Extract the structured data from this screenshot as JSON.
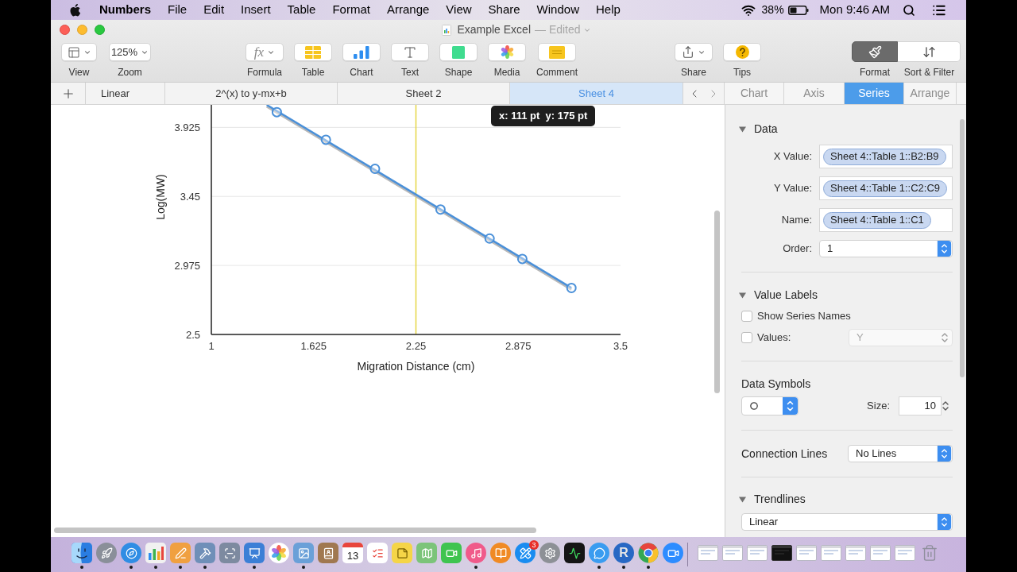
{
  "menu_bar": {
    "app_name": "Numbers",
    "menus": [
      "File",
      "Edit",
      "Insert",
      "Table",
      "Format",
      "Arrange",
      "View",
      "Share",
      "Window",
      "Help"
    ],
    "battery": "38%",
    "clock": "Mon 9:46 AM"
  },
  "window": {
    "title": "Example Excel",
    "status": "— Edited"
  },
  "toolbar": {
    "left": [
      {
        "kind": "view",
        "label": "View"
      },
      {
        "kind": "zoom",
        "label": "Zoom",
        "value": "125%"
      }
    ],
    "insert": [
      {
        "kind": "formula",
        "label": "Formula",
        "icon_text": "fx"
      },
      {
        "kind": "table",
        "label": "Table"
      },
      {
        "kind": "chart",
        "label": "Chart"
      },
      {
        "kind": "text",
        "label": "Text"
      },
      {
        "kind": "shape",
        "label": "Shape"
      },
      {
        "kind": "media",
        "label": "Media"
      },
      {
        "kind": "comment",
        "label": "Comment"
      }
    ],
    "right": [
      {
        "kind": "share",
        "label": "Share"
      },
      {
        "kind": "tips",
        "label": "Tips"
      }
    ],
    "panels": [
      {
        "kind": "format",
        "label": "Format",
        "selected": true
      },
      {
        "kind": "sort",
        "label": "Sort & Filter",
        "selected": false
      }
    ]
  },
  "sheet_tabs": [
    {
      "label": "Linear",
      "selected": false
    },
    {
      "label": "2^(x) to y-mx+b",
      "selected": false
    },
    {
      "label": "Sheet 2",
      "selected": false
    },
    {
      "label": "Sheet 4",
      "selected": true
    }
  ],
  "chart": {
    "tooltip": "x: 111 pt  y: 175 pt",
    "trendline_visible": true,
    "chart_data": {
      "type": "scatter",
      "xlabel": "Migration Distance (cm)",
      "ylabel": "Log(MW)",
      "x": [
        1.4,
        1.7,
        2.0,
        2.4,
        2.7,
        2.9,
        3.2
      ],
      "series": [
        {
          "color": "#4a90d9",
          "values": [
            4.03,
            3.84,
            3.64,
            3.36,
            3.16,
            3.02,
            2.82
          ]
        }
      ],
      "xlim": [
        1,
        3.5
      ],
      "ylim": [
        2.5,
        4.08
      ],
      "xticks": [
        1,
        1.625,
        2.25,
        2.875,
        3.5
      ],
      "yticks": [
        2.5,
        2.975,
        3.45,
        3.925
      ],
      "grid": true,
      "ref_lines": [
        {
          "axis": "x",
          "value": 2.25,
          "color": "#e6d544"
        }
      ]
    }
  },
  "inspector": {
    "tabs": [
      {
        "label": "Chart",
        "selected": false
      },
      {
        "label": "Axis",
        "selected": false
      },
      {
        "label": "Series",
        "selected": true
      },
      {
        "label": "Arrange",
        "selected": false
      }
    ],
    "sections": [
      {
        "kind": "data",
        "title": "Data",
        "expanded": true,
        "rows": [
          {
            "kind": "reference",
            "label": "X Value:",
            "value": "Sheet 4::Table 1::B2:B9"
          },
          {
            "kind": "reference",
            "label": "Y Value:",
            "value": "Sheet 4::Table 1::C2:C9"
          },
          {
            "kind": "reference",
            "label": "Name:",
            "value": "Sheet 4::Table 1::C1"
          },
          {
            "kind": "select",
            "label": "Order:",
            "value": "1"
          }
        ]
      },
      {
        "kind": "value_labels",
        "title": "Value Labels",
        "expanded": true,
        "rows": [
          {
            "kind": "checkbox",
            "label": "Show Series Names",
            "checked": false
          },
          {
            "kind": "checkbox_select",
            "label": "Values:",
            "checked": false,
            "value": "Y",
            "disabled": true
          }
        ]
      },
      {
        "kind": "data_symbols",
        "title": "Data Symbols",
        "size_label": "Size:",
        "size": "10"
      },
      {
        "kind": "connection_lines",
        "title": "Connection Lines",
        "value": "No Lines"
      },
      {
        "kind": "trendlines",
        "title": "Trendlines",
        "expanded": true,
        "value": "Linear"
      }
    ]
  },
  "dock": [
    {
      "kind": "finder",
      "running": true
    },
    {
      "kind": "launchpad",
      "running": false
    },
    {
      "kind": "safari",
      "running": true
    },
    {
      "kind": "numbers",
      "running": true
    },
    {
      "kind": "pages",
      "running": true
    },
    {
      "kind": "tools",
      "running": true
    },
    {
      "kind": "scanner",
      "running": false
    },
    {
      "kind": "keynote",
      "running": true
    },
    {
      "kind": "photos",
      "running": false
    },
    {
      "kind": "preview",
      "running": true
    },
    {
      "kind": "contacts",
      "running": false
    },
    {
      "kind": "calendar",
      "text": "13",
      "running": false
    },
    {
      "kind": "reminders",
      "running": false
    },
    {
      "kind": "notes",
      "running": false
    },
    {
      "kind": "maps",
      "running": false
    },
    {
      "kind": "facetime",
      "running": false
    },
    {
      "kind": "music",
      "running": true
    },
    {
      "kind": "books",
      "running": false
    },
    {
      "kind": "appstore",
      "badge": "3",
      "running": false
    },
    {
      "kind": "settings",
      "running": false
    },
    {
      "kind": "monitor",
      "running": false
    },
    {
      "kind": "messages",
      "running": true
    },
    {
      "kind": "r",
      "text": "R",
      "running": true
    },
    {
      "kind": "chrome",
      "running": true
    },
    {
      "kind": "video",
      "running": false
    },
    {
      "kind": "window"
    },
    {
      "kind": "window"
    },
    {
      "kind": "window"
    },
    {
      "kind": "window_dark"
    },
    {
      "kind": "window"
    },
    {
      "kind": "window"
    },
    {
      "kind": "window"
    },
    {
      "kind": "window"
    },
    {
      "kind": "window"
    },
    {
      "kind": "trash"
    }
  ]
}
